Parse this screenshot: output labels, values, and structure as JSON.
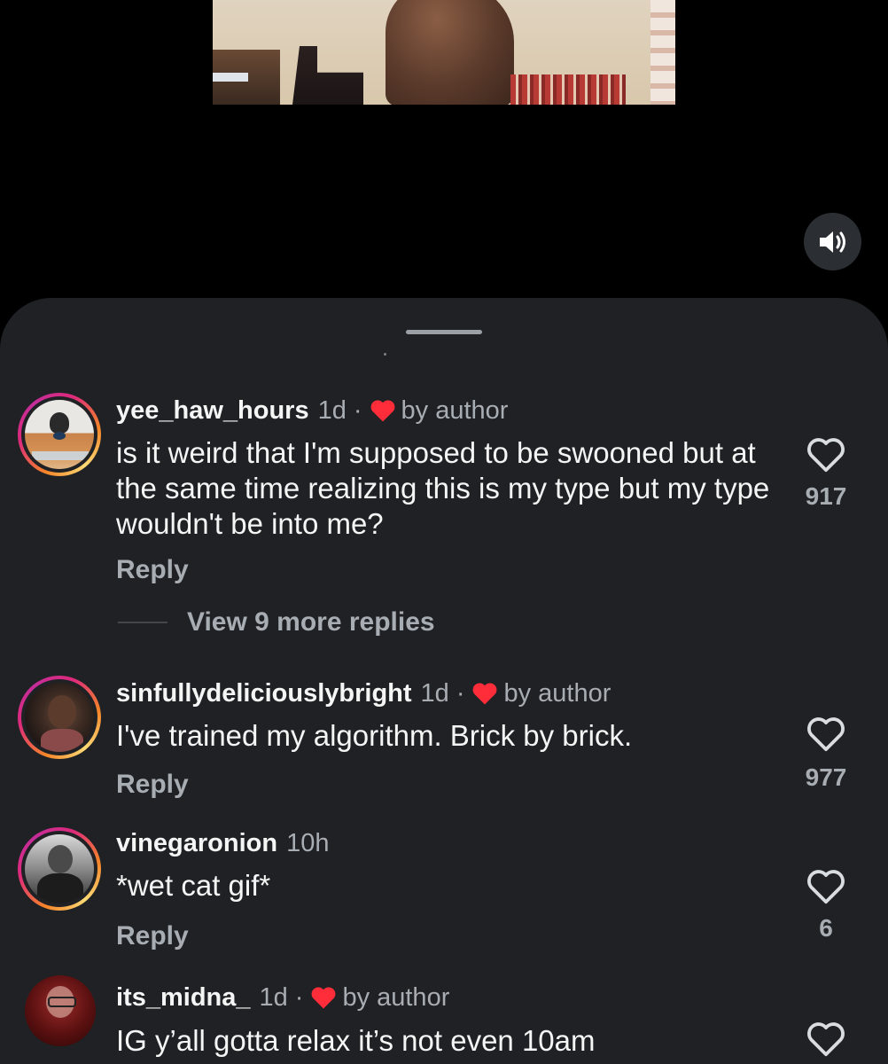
{
  "video": {
    "sound_icon": "speaker-on-icon"
  },
  "comments": [
    {
      "username": "yee_haw_hours",
      "time": "1d",
      "liked_by_author": true,
      "author_label": "by author",
      "text": "is it weird that I'm supposed to be swooned but at the same time realizing this is my type but my type wouldn't be into me?",
      "reply_label": "Reply",
      "likes": "917",
      "view_replies": "View 9 more replies"
    },
    {
      "username": "sinfullydeliciouslybright",
      "time": "1d",
      "liked_by_author": true,
      "author_label": "by author",
      "text": "I've trained my algorithm. Brick by brick.",
      "reply_label": "Reply",
      "likes": "977"
    },
    {
      "username": "vinegaronion",
      "time": "10h",
      "liked_by_author": false,
      "text": "*wet cat gif*",
      "reply_label": "Reply",
      "likes": "6"
    },
    {
      "username": "its_midna_",
      "time": "1d",
      "liked_by_author": true,
      "author_label": "by author",
      "text": "IG y’all gotta relax it’s not even 10am"
    }
  ],
  "colors": {
    "sheet_background": "#1f2124",
    "primary_text": "#f5f5f5",
    "secondary_text": "#a8adb3",
    "author_heart": "#ff2d3a"
  }
}
